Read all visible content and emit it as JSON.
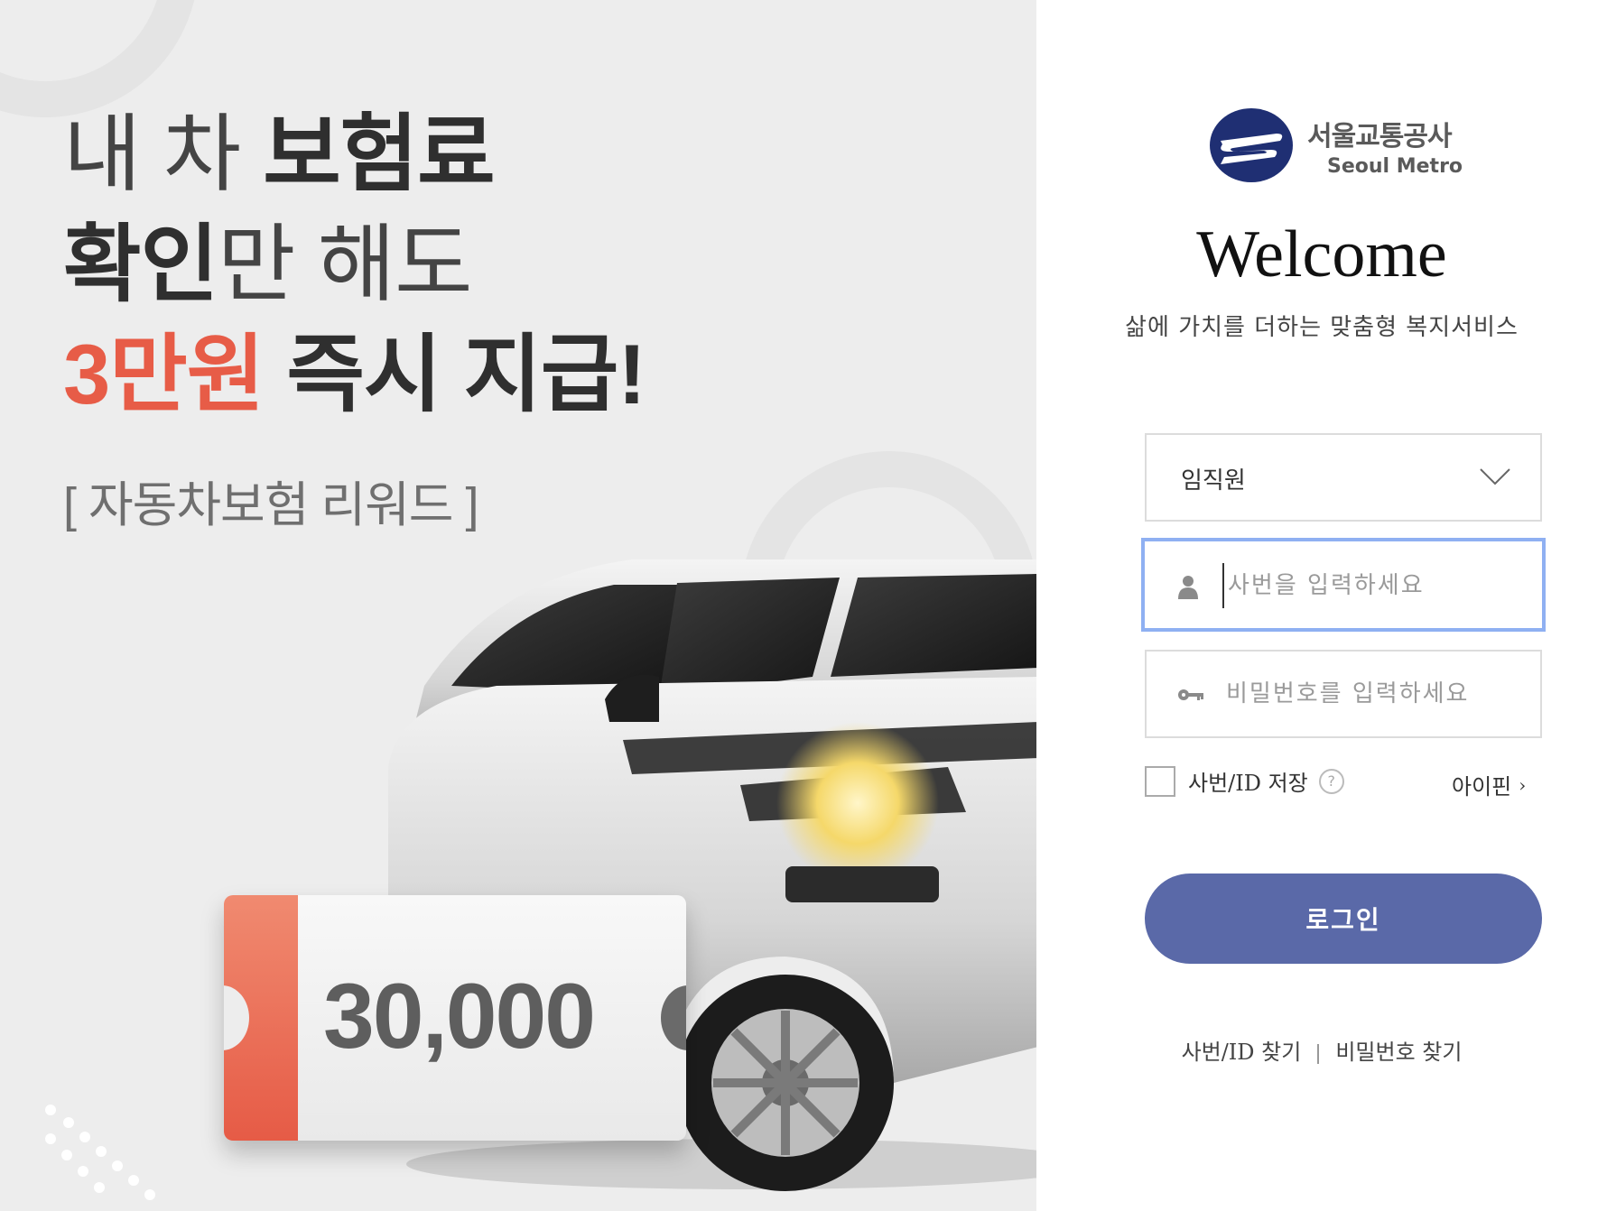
{
  "promo": {
    "headline_line1_light": "내 차 ",
    "headline_line1_bold": "보험료",
    "headline_line2_bold": "확인",
    "headline_line2_light": "만 해도",
    "headline_line3_accent": "3만원",
    "headline_line3_bold": " 즉시 지급!",
    "subhead": "[ 자동차보험 리워드 ]",
    "coupon_amount": "30,000",
    "accent_color": "#e75c47"
  },
  "login": {
    "logo_kr": "서울교통공사",
    "logo_en": "Seoul Metro",
    "logo_icon": "seoul-metro-logo-icon",
    "welcome": "Welcome",
    "tagline": "삶에 가치를 더하는 맞춤형 복지서비스",
    "member_type": {
      "selected": "임직원"
    },
    "user_field": {
      "placeholder": "사번을 입력하세요",
      "icon": "user-icon"
    },
    "password_field": {
      "placeholder": "비밀번호를 입력하세요",
      "icon": "key-icon"
    },
    "remember_label": "사번/ID 저장",
    "help_glyph": "?",
    "ipin_label": "아이핀",
    "ipin_arrow": "›",
    "login_button": "로그인",
    "button_color": "#5a69a8",
    "find_id": "사번/ID 찾기",
    "find_password": "비밀번호 찾기"
  }
}
